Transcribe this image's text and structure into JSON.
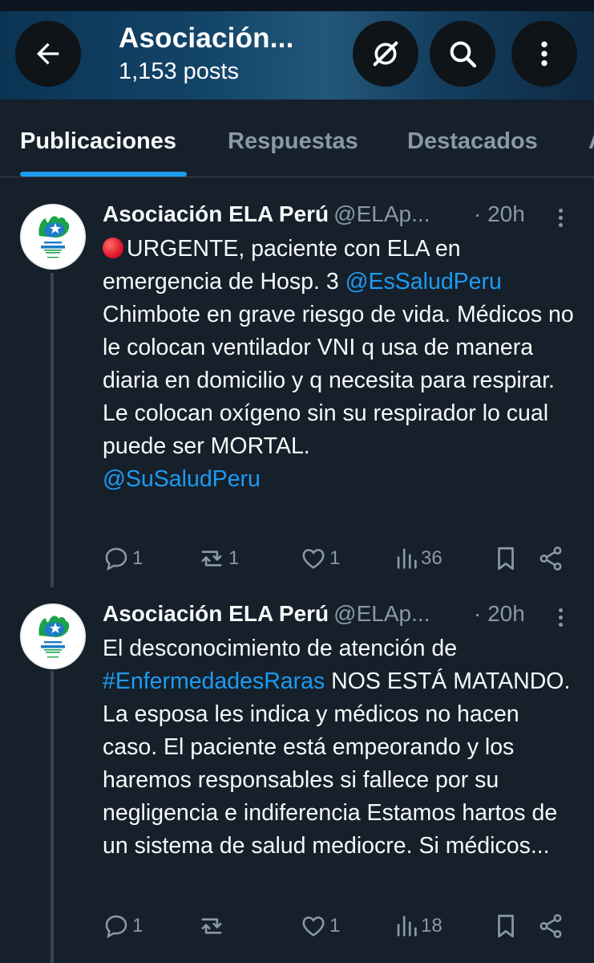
{
  "header": {
    "title": "Asociación...",
    "post_count": "1,153 posts",
    "icons": [
      "back-arrow-icon",
      "grok-icon",
      "search-icon",
      "more-vertical-icon"
    ]
  },
  "tabs": [
    {
      "label": "Publicaciones",
      "active": true
    },
    {
      "label": "Respuestas",
      "active": false
    },
    {
      "label": "Destacados",
      "active": false
    },
    {
      "label": "A",
      "active": false
    }
  ],
  "posts": [
    {
      "author": "Asociación ELA Perú",
      "handle": "@ELAp...",
      "time": "· 20h",
      "body": {
        "prefix_icon": "red-circle-emoji",
        "p1": "URGENTE, paciente con ELA en emergencia de Hosp. 3 ",
        "mention1": "@EsSaludPeru",
        "p2": " Chimbote en grave riesgo de vida. Médicos no le colocan ventilador VNI q usa de manera diaria en domicilio y q necesita para respirar. Le  colocan oxígeno sin su respirador lo cual puede ser MORTAL.",
        "mention2": "@SuSaludPeru"
      },
      "stats": {
        "replies": "1",
        "reposts": "1",
        "likes": "1",
        "views": "36"
      }
    },
    {
      "author": "Asociación ELA Perú",
      "handle": "@ELAp...",
      "time": "· 20h",
      "body": {
        "p1": "El desconocimiento de atención de ",
        "hashtag": "#EnfermedadesRaras",
        "p2": " NOS ESTÁ MATANDO. La esposa les indica y médicos no hacen caso. El paciente está empeorando y los haremos responsables si fallece por su negligencia e indiferencia Estamos hartos de un sistema de salud mediocre. Si médicos..."
      },
      "stats": {
        "replies": "1",
        "reposts": "",
        "likes": "1",
        "views": "18"
      }
    }
  ],
  "colors": {
    "background": "#15202b",
    "accent": "#1d9bf0",
    "muted": "#8b98a5",
    "divider": "#38444d"
  }
}
